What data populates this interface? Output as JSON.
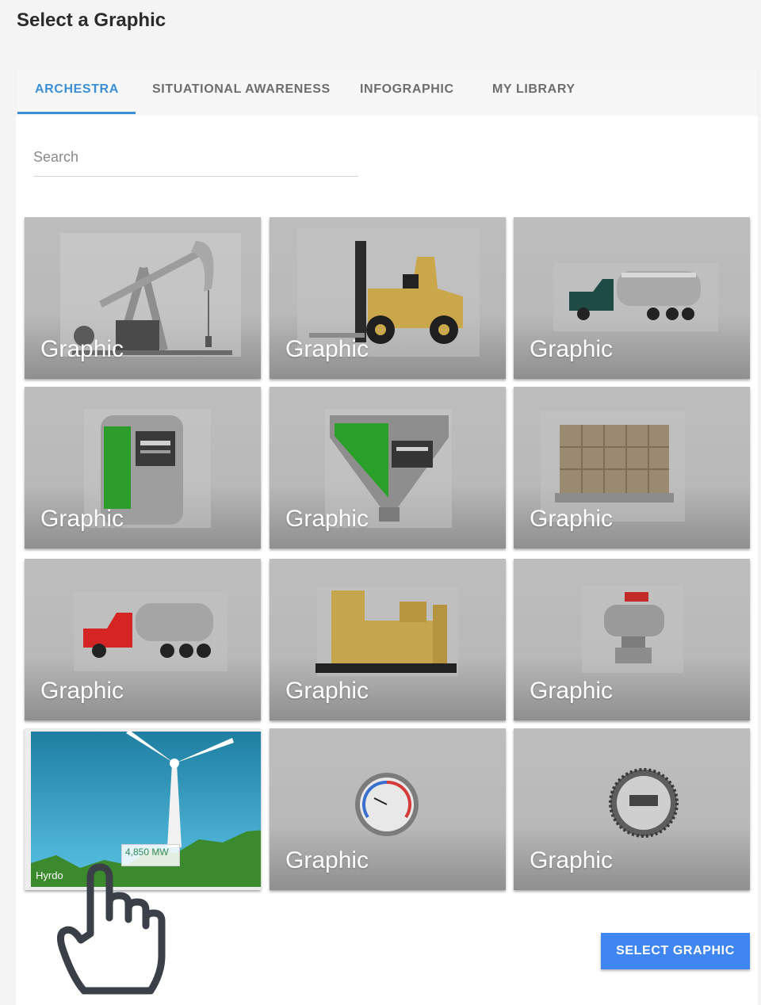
{
  "dialog": {
    "title": "Select a Graphic"
  },
  "tabs": [
    {
      "label": "ARCHESTRA",
      "active": true
    },
    {
      "label": "SITUATIONAL AWARENESS",
      "active": false
    },
    {
      "label": "INFOGRAPHIC",
      "active": false
    },
    {
      "label": "MY LIBRARY",
      "active": false
    }
  ],
  "search": {
    "placeholder": "Search",
    "value": ""
  },
  "cards": [
    {
      "label": "Graphic",
      "icon": "pumpjack-icon"
    },
    {
      "label": "Graphic",
      "icon": "forklift-icon"
    },
    {
      "label": "Graphic",
      "icon": "tanker-truck-green-icon"
    },
    {
      "label": "Graphic",
      "icon": "storage-tank-icon"
    },
    {
      "label": "Graphic",
      "icon": "hopper-icon"
    },
    {
      "label": "Graphic",
      "icon": "pallet-boxes-icon"
    },
    {
      "label": "Graphic",
      "icon": "tanker-truck-red-icon"
    },
    {
      "label": "Graphic",
      "icon": "generator-icon"
    },
    {
      "label": "Graphic",
      "icon": "valve-icon"
    },
    {
      "label": "Hyrdo",
      "icon": "wind-turbine-icon",
      "readout": "4,850 MW"
    },
    {
      "label": "Graphic",
      "icon": "pressure-gauge-icon"
    },
    {
      "label": "Graphic",
      "icon": "meter-gauge-icon"
    }
  ],
  "footer": {
    "select_button": "SELECT GRAPHIC"
  },
  "colors": {
    "accent": "#3a8fd6",
    "button": "#3f86f2"
  }
}
